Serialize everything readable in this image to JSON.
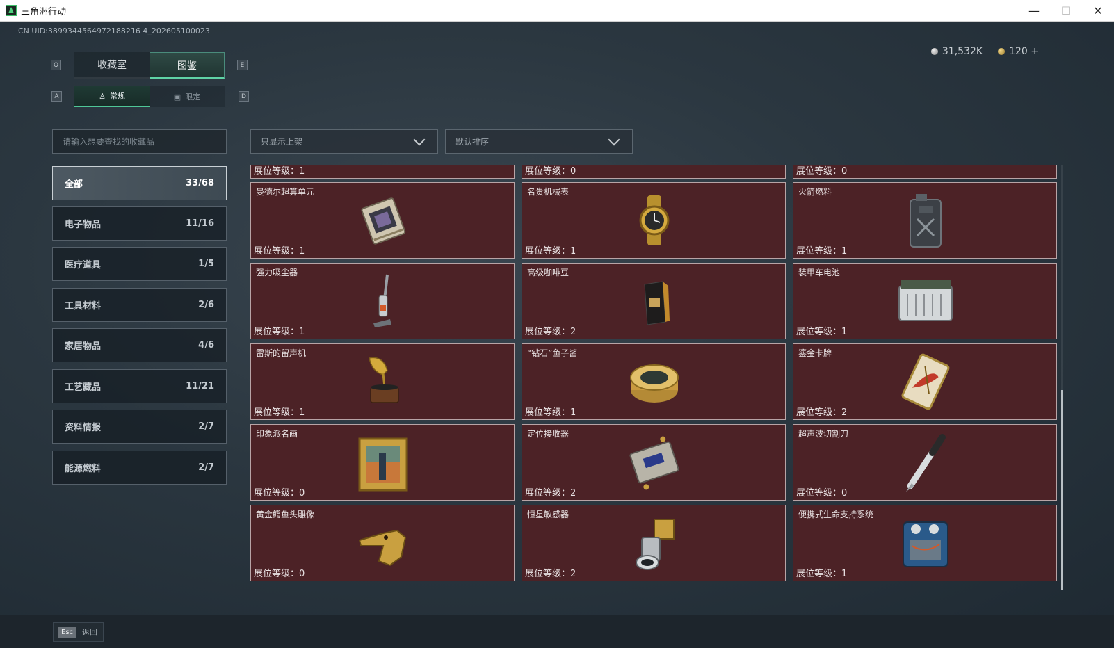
{
  "window": {
    "title": "三角洲行动",
    "minimize": "—",
    "maximize": "☐",
    "close": "✕"
  },
  "uid": "CN UID:3899344564972188216 4_202605100023",
  "currency": {
    "silver": "31,532K",
    "gold": "120 +"
  },
  "tabs": {
    "key_left": "Q",
    "key_right": "E",
    "items": [
      {
        "label": "收藏室"
      },
      {
        "label": "图鉴"
      }
    ]
  },
  "subtabs": {
    "key_left": "A",
    "key_right": "D",
    "items": [
      {
        "label": "常规",
        "icon": "person-icon"
      },
      {
        "label": "限定",
        "icon": "image-icon"
      }
    ]
  },
  "search": {
    "placeholder": "请输入想要查找的收藏品"
  },
  "filters": {
    "shelf": "只显示上架",
    "sort": "默认排序"
  },
  "categories": [
    {
      "label": "全部",
      "count": "33/68"
    },
    {
      "label": "电子物品",
      "count": "11/16"
    },
    {
      "label": "医疗道具",
      "count": "1/5"
    },
    {
      "label": "工具材料",
      "count": "2/6"
    },
    {
      "label": "家居物品",
      "count": "4/6"
    },
    {
      "label": "工艺藏品",
      "count": "11/21"
    },
    {
      "label": "资料情报",
      "count": "2/7"
    },
    {
      "label": "能源燃料",
      "count": "2/7"
    }
  ],
  "level_prefix": "展位等级：",
  "partial_row": [
    {
      "level": "展位等级：1"
    },
    {
      "level": "展位等级：0"
    },
    {
      "level": "展位等级：0"
    }
  ],
  "items": [
    {
      "name": "曼德尔超算单元",
      "level": "展位等级：1",
      "icon": "supercomputer-icon"
    },
    {
      "name": "名贵机械表",
      "level": "展位等级：1",
      "icon": "watch-icon"
    },
    {
      "name": "火箭燃料",
      "level": "展位等级：1",
      "icon": "fuel-can-icon"
    },
    {
      "name": "强力吸尘器",
      "level": "展位等级：1",
      "icon": "vacuum-icon"
    },
    {
      "name": "高级咖啡豆",
      "level": "展位等级：2",
      "icon": "coffee-bag-icon"
    },
    {
      "name": "装甲车电池",
      "level": "展位等级：1",
      "icon": "battery-icon"
    },
    {
      "name": "雷斯的留声机",
      "level": "展位等级：1",
      "icon": "gramophone-icon"
    },
    {
      "name": "“钻石”鱼子酱",
      "level": "展位等级：1",
      "icon": "caviar-tin-icon"
    },
    {
      "name": "鎏金卡牌",
      "level": "展位等级：2",
      "icon": "gold-card-icon"
    },
    {
      "name": "印象派名画",
      "level": "展位等级：0",
      "icon": "painting-icon"
    },
    {
      "name": "定位接收器",
      "level": "展位等级：2",
      "icon": "receiver-icon"
    },
    {
      "name": "超声波切割刀",
      "level": "展位等级：0",
      "icon": "ultrasonic-knife-icon"
    },
    {
      "name": "黄金鳄鱼头雕像",
      "level": "展位等级：0",
      "icon": "croc-statue-icon"
    },
    {
      "name": "恒星敏感器",
      "level": "展位等级：2",
      "icon": "star-sensor-icon"
    },
    {
      "name": "便携式生命支持系统",
      "level": "展位等级：1",
      "icon": "life-support-icon"
    }
  ],
  "footer": {
    "esc_key": "Esc",
    "esc_label": "返回"
  },
  "colors": {
    "card_bg": "#4c2226",
    "accent": "#5fd3a5",
    "card_border": "#b8a4a6"
  }
}
